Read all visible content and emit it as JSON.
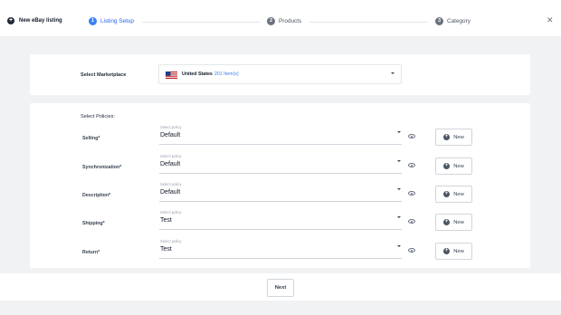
{
  "header": {
    "title": "New eBay listing",
    "steps": [
      {
        "num": "1",
        "label": "Listing Setup"
      },
      {
        "num": "2",
        "label": "Products"
      },
      {
        "num": "3",
        "label": "Category"
      }
    ],
    "close_icon": "close-icon"
  },
  "marketplace": {
    "label": "Select Marketplace",
    "country": "United States",
    "count": "201 Item(s)"
  },
  "policies": {
    "title": "Select Policies:",
    "select_hint": "Select policy",
    "new_label": "New",
    "rows": [
      {
        "label": "Selling*",
        "value": "Default"
      },
      {
        "label": "Synchronization*",
        "value": "Default"
      },
      {
        "label": "Description*",
        "value": "Default"
      },
      {
        "label": "Shipping*",
        "value": "Test"
      },
      {
        "label": "Return*",
        "value": "Test"
      }
    ]
  },
  "footer": {
    "next_label": "Next"
  },
  "colors": {
    "accent": "#3b82f6",
    "active_step_text": "#2563eb",
    "inactive_step": "#6b7280"
  }
}
